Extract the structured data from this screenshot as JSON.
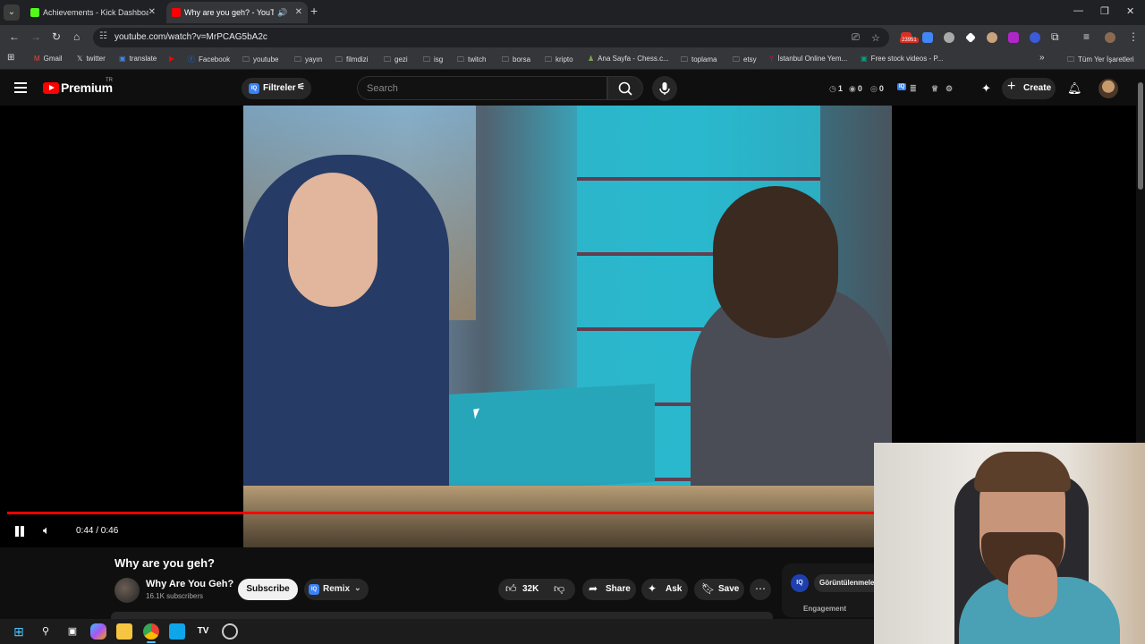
{
  "browser": {
    "tabs": [
      {
        "title": "Achievements - Kick Dashboard",
        "favicon_color": "#53fc18"
      },
      {
        "title": "Why are you geh? - YouTube",
        "favicon_color": "#ff0000"
      }
    ],
    "url": "youtube.com/watch?v=MrPCAG5bA2c",
    "extension_badge": "23951",
    "bookmarks": [
      {
        "label": "Gmail",
        "icon": "gmail-icon"
      },
      {
        "label": "twitter",
        "icon": "x-icon"
      },
      {
        "label": "translate",
        "icon": "translate-icon"
      },
      {
        "label": "",
        "icon": "youtube-icon"
      },
      {
        "label": "Facebook",
        "icon": "facebook-icon"
      },
      {
        "label": "youtube",
        "icon": "folder-icon"
      },
      {
        "label": "yayın",
        "icon": "folder-icon"
      },
      {
        "label": "filmdizi",
        "icon": "folder-icon"
      },
      {
        "label": "gezi",
        "icon": "folder-icon"
      },
      {
        "label": "isg",
        "icon": "folder-icon"
      },
      {
        "label": "twitch",
        "icon": "folder-icon"
      },
      {
        "label": "borsa",
        "icon": "folder-icon"
      },
      {
        "label": "kripto",
        "icon": "folder-icon"
      },
      {
        "label": "Ana Sayfa - Chess.c...",
        "icon": "chess-icon"
      },
      {
        "label": "toplama",
        "icon": "folder-icon"
      },
      {
        "label": "etsy",
        "icon": "folder-icon"
      },
      {
        "label": "İstanbul Online Yem...",
        "icon": "yemek-icon"
      },
      {
        "label": "Free stock videos - P...",
        "icon": "pexels-icon"
      }
    ],
    "all_bookmarks": "Tüm Yer İşaretleri",
    "overflow": "»"
  },
  "youtube": {
    "logo_text": "Premium",
    "country": "TR",
    "filters_label": "Filtreler",
    "search_placeholder": "Search",
    "stats": [
      {
        "icon": "clock-icon",
        "value": "1"
      },
      {
        "icon": "eye-icon",
        "value": "0"
      },
      {
        "icon": "eye-off-icon",
        "value": "0"
      }
    ],
    "create_label": "Create"
  },
  "player": {
    "time": "0:44 / 0:46",
    "progress": 0.96
  },
  "video": {
    "title": "Why are you geh?",
    "channel": "Why Are You Geh?",
    "subscribers": "16.1K subscribers",
    "subscribe_label": "Subscribe",
    "remix_label": "Remix",
    "likes": "32K",
    "share_label": "Share",
    "ask_label": "Ask",
    "save_label": "Save",
    "side_tab": "Görüntülenmeler",
    "side_engagement": "Engagement"
  },
  "colors": {
    "accent": "#ff0000",
    "background": "#0f0f0f"
  }
}
